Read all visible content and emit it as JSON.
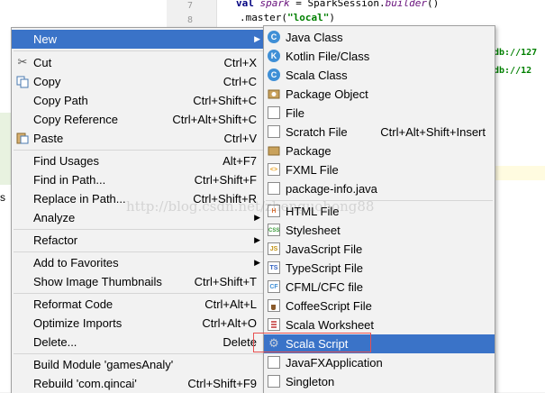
{
  "editor": {
    "line_numbers": [
      "7",
      "8"
    ],
    "line1": {
      "kw": "val",
      "var": "spark",
      "rest": " = SparkSession.",
      "call": "builder",
      "end": "()"
    },
    "line2": {
      "prefix": ".master(",
      "str": "\"local\"",
      "suffix": ")"
    },
    "refs": [
      "db://127",
      "db://12"
    ],
    "left_fragment": "s"
  },
  "main_menu": {
    "items": [
      {
        "label": "New",
        "shortcut": "",
        "submenu": true,
        "selected": true,
        "icon": ""
      },
      {
        "label": "Cut",
        "shortcut": "Ctrl+X",
        "icon": "scissors-icon"
      },
      {
        "label": "Copy",
        "shortcut": "Ctrl+C",
        "icon": "copy-icon"
      },
      {
        "label": "Copy Path",
        "shortcut": "Ctrl+Shift+C"
      },
      {
        "label": "Copy Reference",
        "shortcut": "Ctrl+Alt+Shift+C"
      },
      {
        "label": "Paste",
        "shortcut": "Ctrl+V",
        "icon": "paste-icon"
      },
      {
        "label": "Find Usages",
        "shortcut": "Alt+F7"
      },
      {
        "label": "Find in Path...",
        "shortcut": "Ctrl+Shift+F"
      },
      {
        "label": "Replace in Path...",
        "shortcut": "Ctrl+Shift+R"
      },
      {
        "label": "Analyze",
        "shortcut": "",
        "submenu": true
      },
      {
        "label": "Refactor",
        "shortcut": "",
        "submenu": true
      },
      {
        "label": "Add to Favorites",
        "shortcut": "",
        "submenu": true
      },
      {
        "label": "Show Image Thumbnails",
        "shortcut": "Ctrl+Shift+T"
      },
      {
        "label": "Reformat Code",
        "shortcut": "Ctrl+Alt+L"
      },
      {
        "label": "Optimize Imports",
        "shortcut": "Ctrl+Alt+O"
      },
      {
        "label": "Delete...",
        "shortcut": "Delete"
      },
      {
        "label": "Build Module 'gamesAnaly'",
        "shortcut": ""
      },
      {
        "label": "Rebuild 'com.qincai'",
        "shortcut": "Ctrl+Shift+F9"
      }
    ]
  },
  "sub_menu": {
    "items": [
      {
        "label": "Java Class",
        "shortcut": "",
        "icon": "java-class-icon",
        "glyph": "C",
        "color": "#3f8fd6"
      },
      {
        "label": "Kotlin File/Class",
        "shortcut": "",
        "icon": "kotlin-file-icon",
        "glyph": "K",
        "color": "#3f8fd6"
      },
      {
        "label": "Scala Class",
        "shortcut": "",
        "icon": "scala-class-icon",
        "glyph": "C",
        "color": "#3f8fd6"
      },
      {
        "label": "Package Object",
        "shortcut": "",
        "icon": "package-object-icon",
        "glyph": "",
        "color": "#c9a25c"
      },
      {
        "label": "File",
        "shortcut": "",
        "icon": "file-icon",
        "glyph": "",
        "color": "#ffffff"
      },
      {
        "label": "Scratch File",
        "shortcut": "Ctrl+Alt+Shift+Insert",
        "icon": "scratch-file-icon",
        "glyph": "",
        "color": "#ffffff"
      },
      {
        "label": "Package",
        "shortcut": "",
        "icon": "package-icon",
        "glyph": "",
        "color": "#c9a25c"
      },
      {
        "label": "FXML File",
        "shortcut": "",
        "icon": "fxml-file-icon",
        "glyph": "<>",
        "color": "#e8a020"
      },
      {
        "label": "package-info.java",
        "shortcut": "",
        "icon": "package-info-icon",
        "glyph": "",
        "color": "#ffffff"
      },
      {
        "label": "HTML File",
        "shortcut": "",
        "icon": "html-file-icon",
        "glyph": "H",
        "color": "#e07030"
      },
      {
        "label": "Stylesheet",
        "shortcut": "",
        "icon": "stylesheet-icon",
        "glyph": "CSS",
        "color": "#3a9a3a"
      },
      {
        "label": "JavaScript File",
        "shortcut": "",
        "icon": "javascript-file-icon",
        "glyph": "JS",
        "color": "#e0b020"
      },
      {
        "label": "TypeScript File",
        "shortcut": "",
        "icon": "typescript-file-icon",
        "glyph": "TS",
        "color": "#3060c0"
      },
      {
        "label": "CFML/CFC file",
        "shortcut": "",
        "icon": "cfml-file-icon",
        "glyph": "CF",
        "color": "#3f8fd6"
      },
      {
        "label": "CoffeeScript File",
        "shortcut": "",
        "icon": "coffeescript-file-icon",
        "glyph": "",
        "color": "#8a5a2a"
      },
      {
        "label": "Scala Worksheet",
        "shortcut": "",
        "icon": "scala-worksheet-icon",
        "glyph": "",
        "color": "#c03030"
      },
      {
        "label": "Scala Script",
        "shortcut": "",
        "icon": "scala-script-icon",
        "glyph": "",
        "color": "#808080",
        "selected": true
      },
      {
        "label": "JavaFXApplication",
        "shortcut": "",
        "icon": "javafx-application-icon",
        "glyph": "",
        "color": "#ffffff"
      },
      {
        "label": "Singleton",
        "shortcut": "",
        "icon": "singleton-icon",
        "glyph": "",
        "color": "#ffffff"
      }
    ]
  },
  "watermark": "http://blog.csdn.net/zhenguohong88",
  "colors": {
    "selection": "#3a73c8",
    "highlight_box": "#e85050"
  }
}
